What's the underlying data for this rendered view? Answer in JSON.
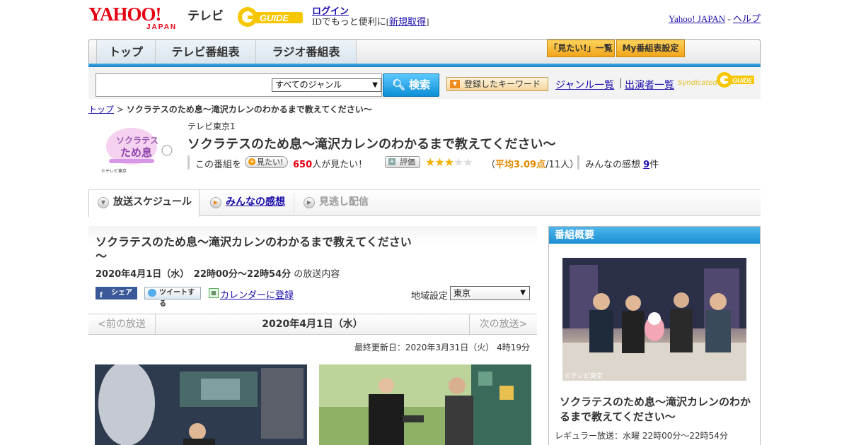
{
  "header": {
    "yahoo_logo_text": "YAHOO!",
    "japan_text": "JAPAN",
    "tv_label": "テレビ",
    "gguide_text": "G-GUIDE",
    "login": "ログイン",
    "login_sub_prefix": "IDでもっと便利に[",
    "signup": "新規取得",
    "login_sub_suffix": "]",
    "yahoo_japan_link": "Yahoo! JAPAN",
    "sep": "-",
    "help_link": "ヘルプ"
  },
  "nav": {
    "tabs": [
      {
        "label": "トップ"
      },
      {
        "label": "テレビ番組表"
      },
      {
        "label": "ラジオ番組表"
      }
    ],
    "mitai_list": "「見たい!」一覧",
    "my_bangumi": "My番組表設定"
  },
  "search": {
    "genre_selected": "すべてのジャンル",
    "button_label": "検索",
    "keyword_button": "登録したキーワード",
    "genre_list_link": "ジャンル一覧",
    "separator": "|",
    "cast_list_link": "出演者一覧",
    "syndicated": "Syndicated"
  },
  "breadcrumb": {
    "top": "トップ",
    "arrow": ">",
    "current": "ソクラテスのため息～滝沢カレンのわかるまで教えてください～"
  },
  "program": {
    "channel": "テレビ東京1",
    "title": "ソクラテスのため息～滝沢カレンのわかるまで教えてください～",
    "thumb_credit": "©テレビ東京",
    "mitai_prefix": "この番組を",
    "mitai_btn": "見たい!",
    "mitai_count": "650",
    "mitai_suffix": "人が見たい！",
    "rating_btn": "評価",
    "rating_open": "（",
    "rating_avg": "平均3.09点",
    "rating_count": "/11人）",
    "kansou_prefix": "みんなの感想",
    "kansou_count": "9",
    "kansou_suffix": "件",
    "stars_filled": 3,
    "stars_total": 5
  },
  "tabs": {
    "schedule": "放送スケジュール",
    "kansou": "みんなの感想",
    "minogashi": "見逃し配信"
  },
  "main": {
    "title": "ソクラテスのため息～滝沢カレンのわかるまで教えてください～",
    "date": "2020年4月1日（水）　22時00分～22時54分",
    "date_suffix": "の放送内容",
    "share_fb": "シェア",
    "share_tw": "ツイートする",
    "calendar": "カレンダーに登録",
    "region_label": "地域設定",
    "region_value": "東京",
    "prev": "<前の放送",
    "current_date": "2020年4月1日（水）",
    "next": "次の放送>",
    "last_updated": "最終更新日：2020年3月31日（火） 4時19分"
  },
  "sidebar": {
    "header": "番組概要",
    "photo_credit": "©テレビ東京",
    "title": "ソクラテスのため息～滝沢カレンのわかるまで教えてください～",
    "regular": "レギュラー放送：水曜 22時00分～22時54分"
  },
  "colors": {
    "yahoo_red": "#e60012",
    "link_blue": "#1a0dab",
    "accent_blue": "#1b8fd2",
    "star_gold": "#f3b000",
    "rating_orange": "#e08a00"
  }
}
